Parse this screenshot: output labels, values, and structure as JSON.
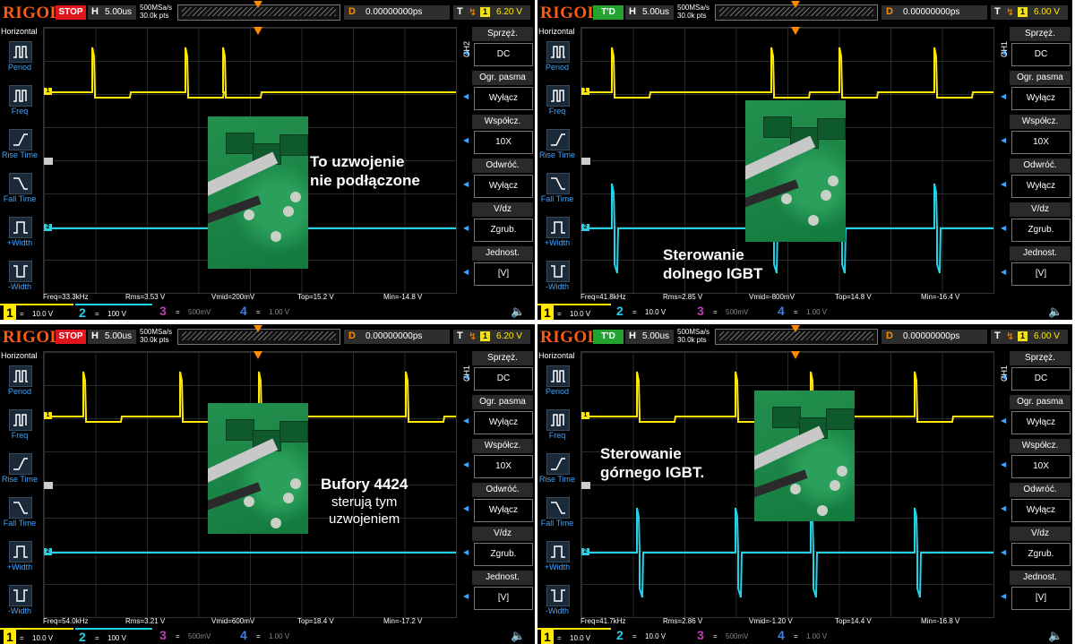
{
  "logo": "RIGOL",
  "colors": {
    "ch1": "#ffe900",
    "ch2": "#22d2e6",
    "ch3": "#c03cb4",
    "ch4": "#3c7ce0",
    "trigger_accent": "#ff8a00",
    "menu_accent": "#3fa6ff"
  },
  "left_menu": {
    "title": "Horizontal",
    "items": [
      {
        "label": "Period",
        "icon": "period-icon"
      },
      {
        "label": "Freq",
        "icon": "freq-icon"
      },
      {
        "label": "Rise Time",
        "icon": "rise-time-icon"
      },
      {
        "label": "Fall Time",
        "icon": "fall-time-icon"
      },
      {
        "label": "+Width",
        "icon": "plus-width-icon"
      },
      {
        "label": "-Width",
        "icon": "minus-width-icon"
      }
    ]
  },
  "right_menu_titles": [
    "Sprzęż.",
    "Ogr. pasma",
    "Współcz.",
    "Odwróć.",
    "V/dz",
    "Jednost."
  ],
  "channel_bar_labels": {
    "ch3_num": "3",
    "ch4_num": "4",
    "ch3_val": "500mV",
    "ch4_val": "1.00 V",
    "ch1_num": "1",
    "ch2_num": "2"
  },
  "screens": [
    {
      "status": "STOP",
      "timebase": "5.00us",
      "sample_rate": "500MSa/s",
      "points": "30.0k pts",
      "delay_key": "D",
      "delay": "0.00000000ps",
      "trig_key": "T",
      "trig_level": "6.20 V",
      "ch_label": "CH2",
      "right_values": [
        "DC",
        "Wyłącz",
        "10X",
        "Wyłącz",
        "Zgrub.",
        "[V]"
      ],
      "measurements": {
        "freq": "Freq=33.3kHz",
        "rms": "Rms=3.53 V",
        "vmid": "Vmid=200mV",
        "top": "Top=15.2 V",
        "min": "Min=-14.8 V"
      },
      "ch1_scale": "10.0 V",
      "ch2_scale": "100 V",
      "caption_lines": [
        "To uzwojenie",
        "nie podłączone"
      ],
      "caption_style": "bold"
    },
    {
      "status": "T'D",
      "timebase": "5.00us",
      "sample_rate": "500MSa/s",
      "points": "30.0k pts",
      "delay_key": "D",
      "delay": "0.00000000ps",
      "trig_key": "T",
      "trig_level": "6.00 V",
      "ch_label": "CH1",
      "right_values": [
        "DC",
        "Wyłącz",
        "10X",
        "Wyłącz",
        "Zgrub.",
        "[V]"
      ],
      "measurements": {
        "freq": "Freq=41.8kHz",
        "rms": "Rms=2.85 V",
        "vmid": "Vmid=-800mV",
        "top": "Top=14.8 V",
        "min": "Min=-16.4 V"
      },
      "ch1_scale": "10.0 V",
      "ch2_scale": "10.0 V",
      "caption_lines": [
        "Sterowanie",
        "dolnego IGBT"
      ],
      "caption_style": "bold"
    },
    {
      "status": "STOP",
      "timebase": "5.00us",
      "sample_rate": "500MSa/s",
      "points": "30.0k pts",
      "delay_key": "D",
      "delay": "0.00000000ps",
      "trig_key": "T",
      "trig_level": "6.20 V",
      "ch_label": "CH1",
      "right_values": [
        "DC",
        "Wyłącz",
        "10X",
        "Wyłącz",
        "Zgrub.",
        "[V]"
      ],
      "measurements": {
        "freq": "Freq=54.0kHz",
        "rms": "Rms=3.21 V",
        "vmid": "Vmid=600mV",
        "top": "Top=18.4 V",
        "min": "Min=-17.2 V"
      },
      "ch1_scale": "10.0 V",
      "ch2_scale": "100 V",
      "caption_lines": [
        "Bufory 4424",
        "sterują tym",
        "uzwojeniem"
      ],
      "caption_style": "mixed"
    },
    {
      "status": "T'D",
      "timebase": "5.00us",
      "sample_rate": "500MSa/s",
      "points": "30.0k pts",
      "delay_key": "D",
      "delay": "0.00000000ps",
      "trig_key": "T",
      "trig_level": "6.00 V",
      "ch_label": "CH1",
      "right_values": [
        "DC",
        "Wyłącz",
        "10X",
        "Wyłącz",
        "Zgrub.",
        "[V]"
      ],
      "measurements": {
        "freq": "Freq=41.7kHz",
        "rms": "Rms=2.86 V",
        "vmid": "Vmid=-1.20 V",
        "top": "Top=14.4 V",
        "min": "Min=-16.8 V"
      },
      "ch1_scale": "10.0 V",
      "ch2_scale": "10.0 V",
      "caption_lines": [
        "Sterowanie",
        "górnego IGBT."
      ],
      "caption_style": "bold"
    }
  ]
}
